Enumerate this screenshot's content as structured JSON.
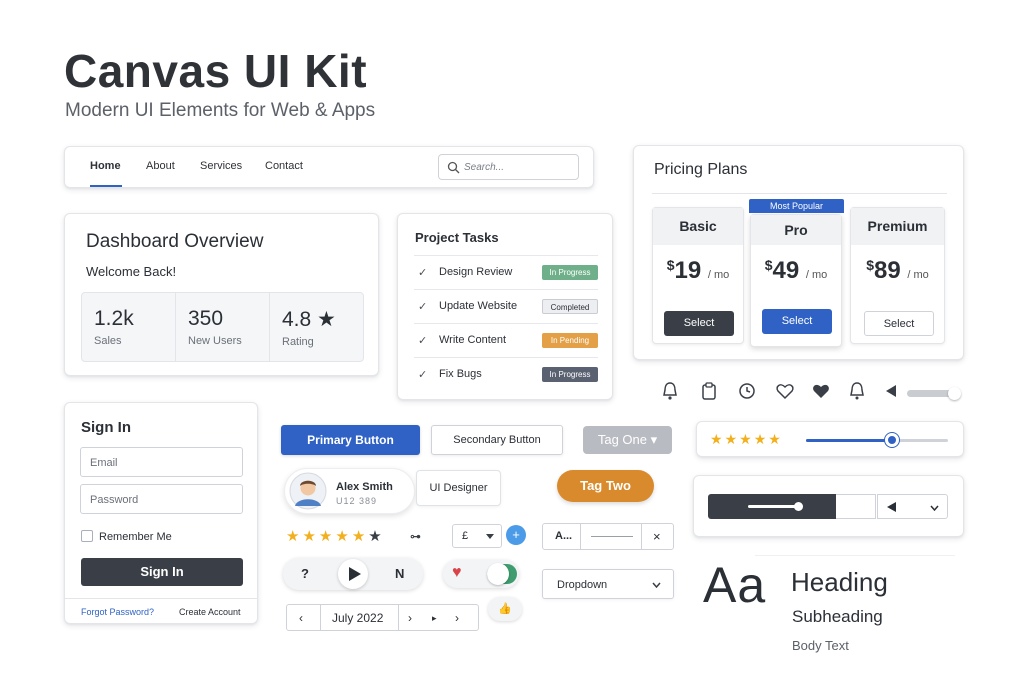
{
  "header": {
    "title": "Canvas UI Kit",
    "subtitle": "Modern UI Elements for Web & Apps"
  },
  "nav": {
    "items": [
      "Home",
      "About",
      "Services",
      "Contact"
    ],
    "active": "Home",
    "search_placeholder": "Search..."
  },
  "dashboard": {
    "title": "Dashboard Overview",
    "welcome": "Welcome Back!",
    "stats": [
      {
        "value": "1.2k",
        "label": "Sales"
      },
      {
        "value": "350",
        "label": "New Users"
      },
      {
        "value": "4.8 ★",
        "label": "Rating"
      }
    ]
  },
  "tasks": {
    "title": "Project Tasks",
    "items": [
      {
        "name": "Design Review",
        "status": "In Progress",
        "status_color": "#6fb08a"
      },
      {
        "name": "Update Website",
        "status": "Completed",
        "status_color": "#e9eaed"
      },
      {
        "name": "Write Content",
        "status": "In Pending",
        "status_color": "#e3a047"
      },
      {
        "name": "Fix Bugs",
        "status": "In Progress",
        "status_color": "#5a6170"
      }
    ]
  },
  "pricing": {
    "title": "Pricing Plans",
    "popular_label": "Most Popular",
    "plans": [
      {
        "name": "Basic",
        "currency": "$",
        "amount": "19",
        "period": "/ mo",
        "button": "Select"
      },
      {
        "name": "Pro",
        "currency": "$",
        "amount": "49",
        "period": "/ mo",
        "button": "Select"
      },
      {
        "name": "Premium",
        "currency": "$",
        "amount": "89",
        "period": "/ mo",
        "button": "Select"
      }
    ]
  },
  "icons_row": [
    "bell-outline-icon",
    "clipboard-icon",
    "clock-icon",
    "heart-outline-icon",
    "heart-filled-icon",
    "bell-icon",
    "play-back-icon"
  ],
  "signin": {
    "title": "Sign In",
    "email_placeholder": "Email",
    "password_placeholder": "Password",
    "remember": "Remember Me",
    "button": "Sign In",
    "forgot": "Forgot Password?",
    "create": "Create Account"
  },
  "buttons": {
    "primary": "Primary Button",
    "secondary": "Secondary Button",
    "tag_one": "Tag One ▾",
    "tag_two": "Tag Two"
  },
  "profile": {
    "name": "Alex Smith",
    "detail": "U12 389",
    "role": "UI Designer"
  },
  "rating": {
    "stars": 5,
    "of": 6
  },
  "currency_select": {
    "value": "£",
    "add": "+"
  },
  "font_field": {
    "value": "A...",
    "close": "×"
  },
  "dropdown": {
    "label": "Dropdown"
  },
  "player": {
    "left": "?",
    "right": "N"
  },
  "date_picker": {
    "value": "July 2022",
    "prev": "‹",
    "next": "›"
  },
  "slider": {
    "value_fraction": 0.6
  },
  "typography": {
    "sample": "Aa",
    "heading": "Heading",
    "subheading": "Subheading",
    "body": "Body Text"
  },
  "colors": {
    "primary": "#2f62c4",
    "dark": "#3a3f47",
    "accent_orange": "#d98a2c",
    "star": "#f2b01e",
    "success": "#3e9c6e"
  }
}
